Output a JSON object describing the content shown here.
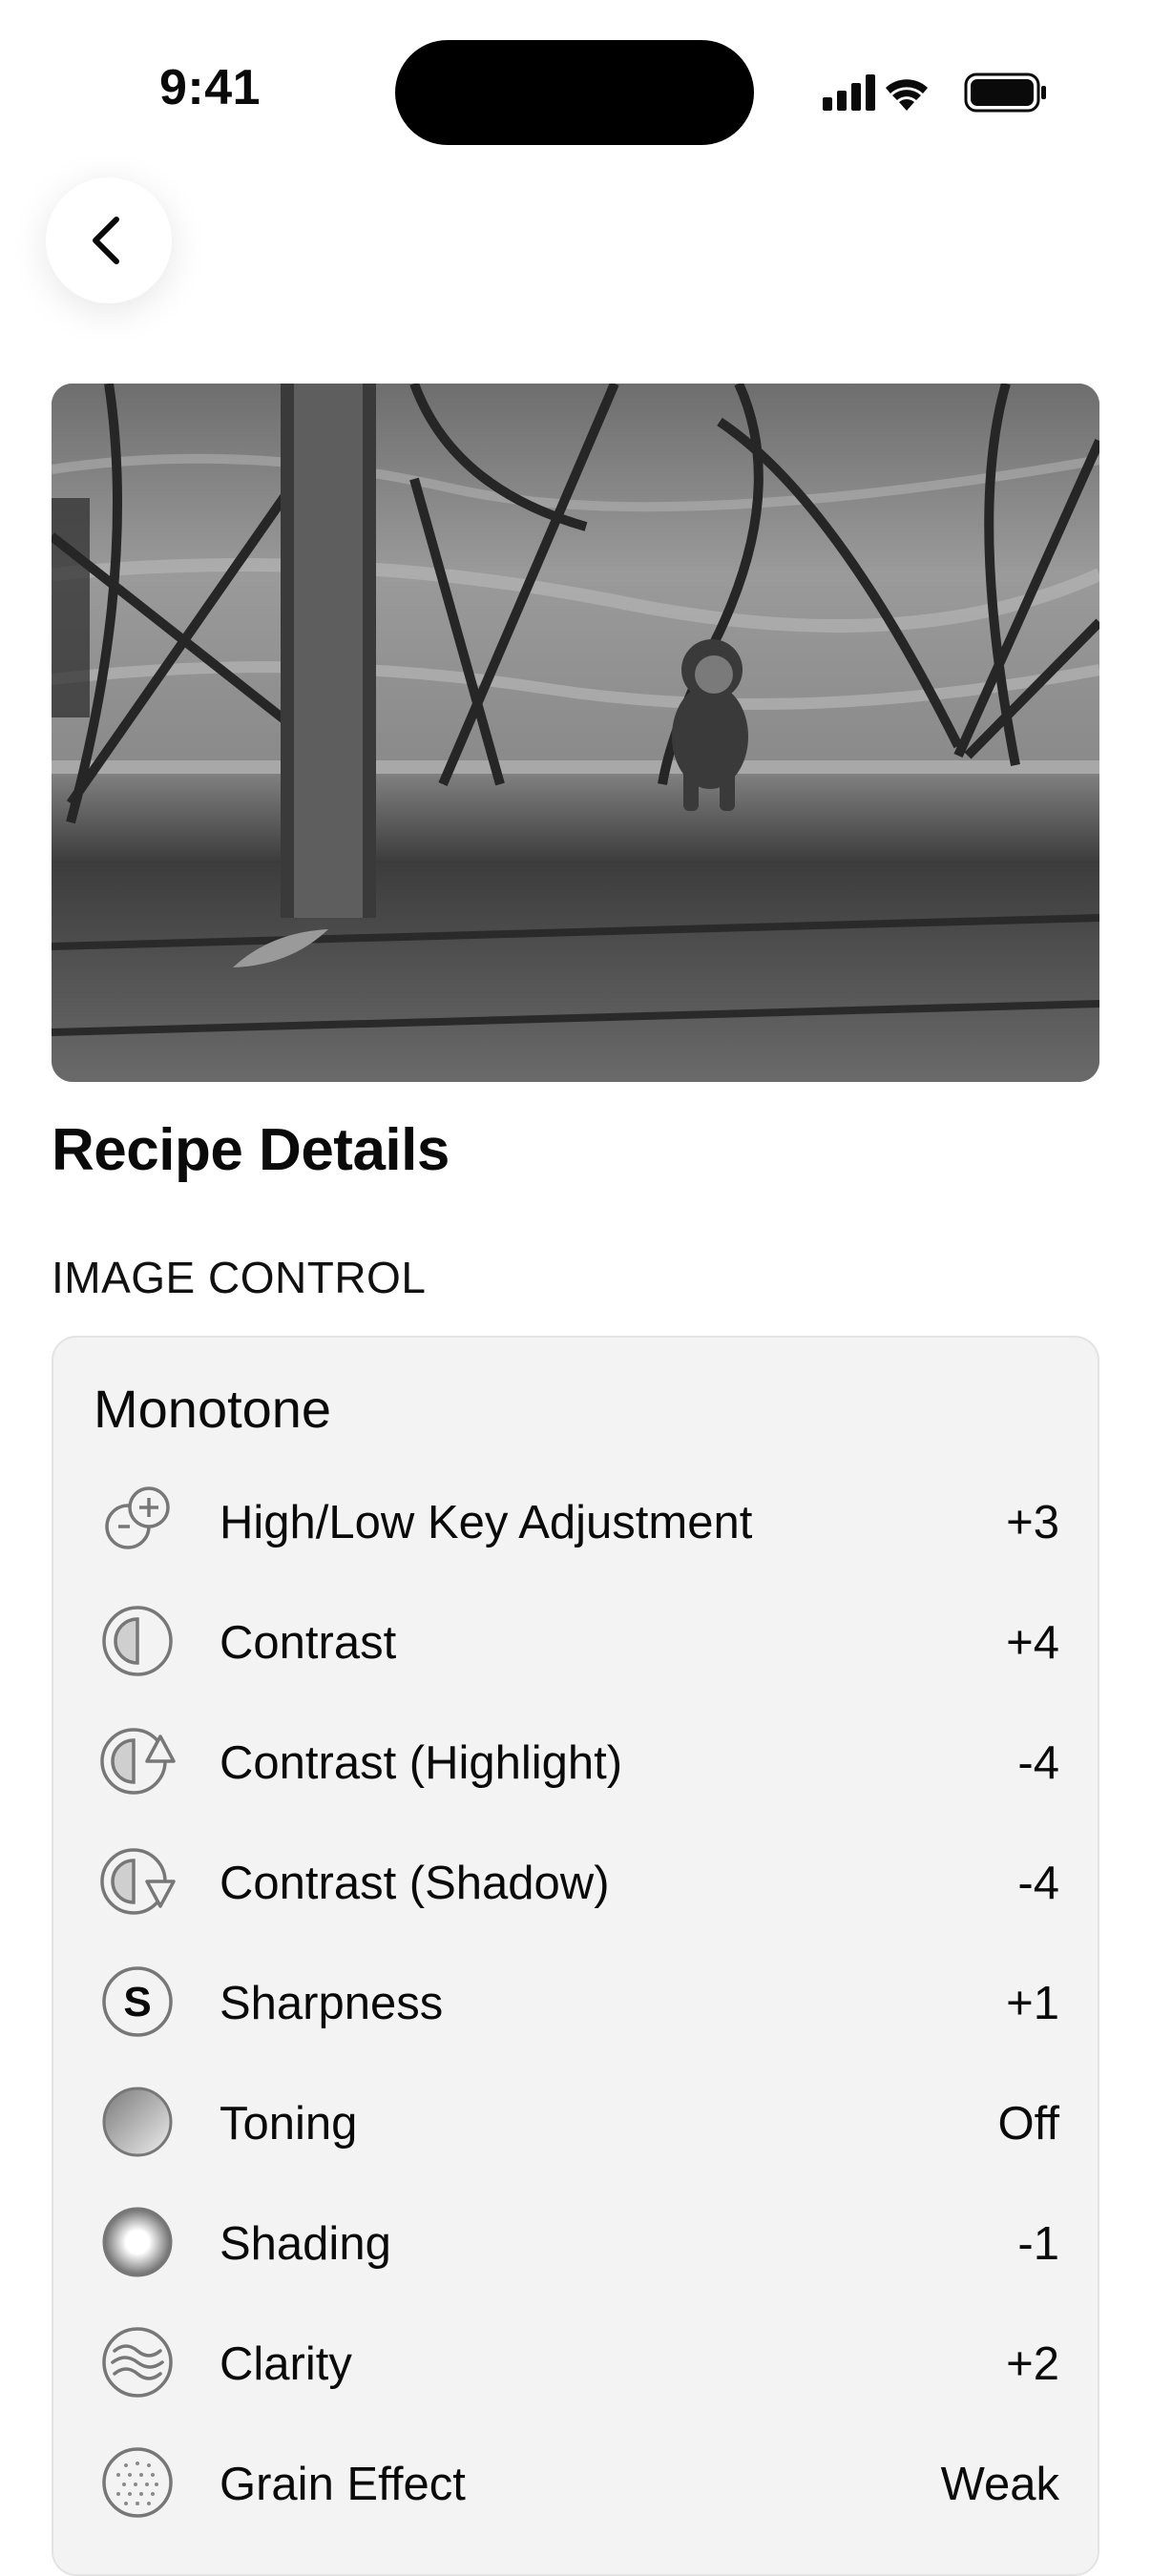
{
  "status_bar": {
    "time": "9:41"
  },
  "page": {
    "title": "Recipe Details"
  },
  "section": {
    "header": "IMAGE CONTROL"
  },
  "card": {
    "title": "Monotone",
    "rows": [
      {
        "label": "High/Low Key Adjustment",
        "value": "+3",
        "icon": "high-low-key-icon"
      },
      {
        "label": "Contrast",
        "value": "+4",
        "icon": "contrast-icon"
      },
      {
        "label": "Contrast (Highlight)",
        "value": "-4",
        "icon": "contrast-highlight-icon"
      },
      {
        "label": "Contrast (Shadow)",
        "value": "-4",
        "icon": "contrast-shadow-icon"
      },
      {
        "label": "Sharpness",
        "value": "+1",
        "icon": "sharpness-icon"
      },
      {
        "label": "Toning",
        "value": "Off",
        "icon": "toning-icon"
      },
      {
        "label": "Shading",
        "value": "-1",
        "icon": "shading-icon"
      },
      {
        "label": "Clarity",
        "value": "+2",
        "icon": "clarity-icon"
      },
      {
        "label": "Grain Effect",
        "value": "Weak",
        "icon": "grain-effect-icon"
      }
    ]
  }
}
